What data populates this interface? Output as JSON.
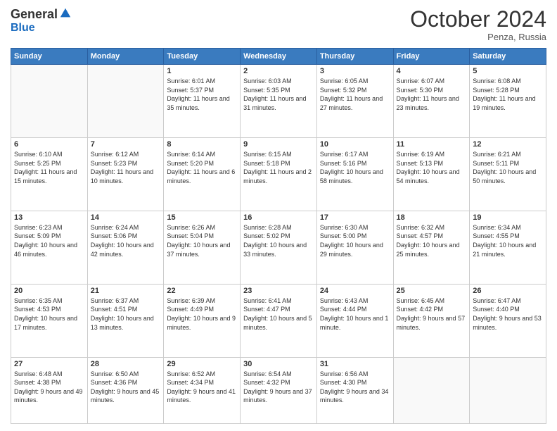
{
  "header": {
    "logo": {
      "general": "General",
      "blue": "Blue"
    },
    "title": "October 2024",
    "location": "Penza, Russia"
  },
  "days_of_week": [
    "Sunday",
    "Monday",
    "Tuesday",
    "Wednesday",
    "Thursday",
    "Friday",
    "Saturday"
  ],
  "weeks": [
    [
      {
        "day": "",
        "info": ""
      },
      {
        "day": "",
        "info": ""
      },
      {
        "day": "1",
        "sunrise": "Sunrise: 6:01 AM",
        "sunset": "Sunset: 5:37 PM",
        "daylight": "Daylight: 11 hours and 35 minutes."
      },
      {
        "day": "2",
        "sunrise": "Sunrise: 6:03 AM",
        "sunset": "Sunset: 5:35 PM",
        "daylight": "Daylight: 11 hours and 31 minutes."
      },
      {
        "day": "3",
        "sunrise": "Sunrise: 6:05 AM",
        "sunset": "Sunset: 5:32 PM",
        "daylight": "Daylight: 11 hours and 27 minutes."
      },
      {
        "day": "4",
        "sunrise": "Sunrise: 6:07 AM",
        "sunset": "Sunset: 5:30 PM",
        "daylight": "Daylight: 11 hours and 23 minutes."
      },
      {
        "day": "5",
        "sunrise": "Sunrise: 6:08 AM",
        "sunset": "Sunset: 5:28 PM",
        "daylight": "Daylight: 11 hours and 19 minutes."
      }
    ],
    [
      {
        "day": "6",
        "sunrise": "Sunrise: 6:10 AM",
        "sunset": "Sunset: 5:25 PM",
        "daylight": "Daylight: 11 hours and 15 minutes."
      },
      {
        "day": "7",
        "sunrise": "Sunrise: 6:12 AM",
        "sunset": "Sunset: 5:23 PM",
        "daylight": "Daylight: 11 hours and 10 minutes."
      },
      {
        "day": "8",
        "sunrise": "Sunrise: 6:14 AM",
        "sunset": "Sunset: 5:20 PM",
        "daylight": "Daylight: 11 hours and 6 minutes."
      },
      {
        "day": "9",
        "sunrise": "Sunrise: 6:15 AM",
        "sunset": "Sunset: 5:18 PM",
        "daylight": "Daylight: 11 hours and 2 minutes."
      },
      {
        "day": "10",
        "sunrise": "Sunrise: 6:17 AM",
        "sunset": "Sunset: 5:16 PM",
        "daylight": "Daylight: 10 hours and 58 minutes."
      },
      {
        "day": "11",
        "sunrise": "Sunrise: 6:19 AM",
        "sunset": "Sunset: 5:13 PM",
        "daylight": "Daylight: 10 hours and 54 minutes."
      },
      {
        "day": "12",
        "sunrise": "Sunrise: 6:21 AM",
        "sunset": "Sunset: 5:11 PM",
        "daylight": "Daylight: 10 hours and 50 minutes."
      }
    ],
    [
      {
        "day": "13",
        "sunrise": "Sunrise: 6:23 AM",
        "sunset": "Sunset: 5:09 PM",
        "daylight": "Daylight: 10 hours and 46 minutes."
      },
      {
        "day": "14",
        "sunrise": "Sunrise: 6:24 AM",
        "sunset": "Sunset: 5:06 PM",
        "daylight": "Daylight: 10 hours and 42 minutes."
      },
      {
        "day": "15",
        "sunrise": "Sunrise: 6:26 AM",
        "sunset": "Sunset: 5:04 PM",
        "daylight": "Daylight: 10 hours and 37 minutes."
      },
      {
        "day": "16",
        "sunrise": "Sunrise: 6:28 AM",
        "sunset": "Sunset: 5:02 PM",
        "daylight": "Daylight: 10 hours and 33 minutes."
      },
      {
        "day": "17",
        "sunrise": "Sunrise: 6:30 AM",
        "sunset": "Sunset: 5:00 PM",
        "daylight": "Daylight: 10 hours and 29 minutes."
      },
      {
        "day": "18",
        "sunrise": "Sunrise: 6:32 AM",
        "sunset": "Sunset: 4:57 PM",
        "daylight": "Daylight: 10 hours and 25 minutes."
      },
      {
        "day": "19",
        "sunrise": "Sunrise: 6:34 AM",
        "sunset": "Sunset: 4:55 PM",
        "daylight": "Daylight: 10 hours and 21 minutes."
      }
    ],
    [
      {
        "day": "20",
        "sunrise": "Sunrise: 6:35 AM",
        "sunset": "Sunset: 4:53 PM",
        "daylight": "Daylight: 10 hours and 17 minutes."
      },
      {
        "day": "21",
        "sunrise": "Sunrise: 6:37 AM",
        "sunset": "Sunset: 4:51 PM",
        "daylight": "Daylight: 10 hours and 13 minutes."
      },
      {
        "day": "22",
        "sunrise": "Sunrise: 6:39 AM",
        "sunset": "Sunset: 4:49 PM",
        "daylight": "Daylight: 10 hours and 9 minutes."
      },
      {
        "day": "23",
        "sunrise": "Sunrise: 6:41 AM",
        "sunset": "Sunset: 4:47 PM",
        "daylight": "Daylight: 10 hours and 5 minutes."
      },
      {
        "day": "24",
        "sunrise": "Sunrise: 6:43 AM",
        "sunset": "Sunset: 4:44 PM",
        "daylight": "Daylight: 10 hours and 1 minute."
      },
      {
        "day": "25",
        "sunrise": "Sunrise: 6:45 AM",
        "sunset": "Sunset: 4:42 PM",
        "daylight": "Daylight: 9 hours and 57 minutes."
      },
      {
        "day": "26",
        "sunrise": "Sunrise: 6:47 AM",
        "sunset": "Sunset: 4:40 PM",
        "daylight": "Daylight: 9 hours and 53 minutes."
      }
    ],
    [
      {
        "day": "27",
        "sunrise": "Sunrise: 6:48 AM",
        "sunset": "Sunset: 4:38 PM",
        "daylight": "Daylight: 9 hours and 49 minutes."
      },
      {
        "day": "28",
        "sunrise": "Sunrise: 6:50 AM",
        "sunset": "Sunset: 4:36 PM",
        "daylight": "Daylight: 9 hours and 45 minutes."
      },
      {
        "day": "29",
        "sunrise": "Sunrise: 6:52 AM",
        "sunset": "Sunset: 4:34 PM",
        "daylight": "Daylight: 9 hours and 41 minutes."
      },
      {
        "day": "30",
        "sunrise": "Sunrise: 6:54 AM",
        "sunset": "Sunset: 4:32 PM",
        "daylight": "Daylight: 9 hours and 37 minutes."
      },
      {
        "day": "31",
        "sunrise": "Sunrise: 6:56 AM",
        "sunset": "Sunset: 4:30 PM",
        "daylight": "Daylight: 9 hours and 34 minutes."
      },
      {
        "day": "",
        "info": ""
      },
      {
        "day": "",
        "info": ""
      }
    ]
  ]
}
